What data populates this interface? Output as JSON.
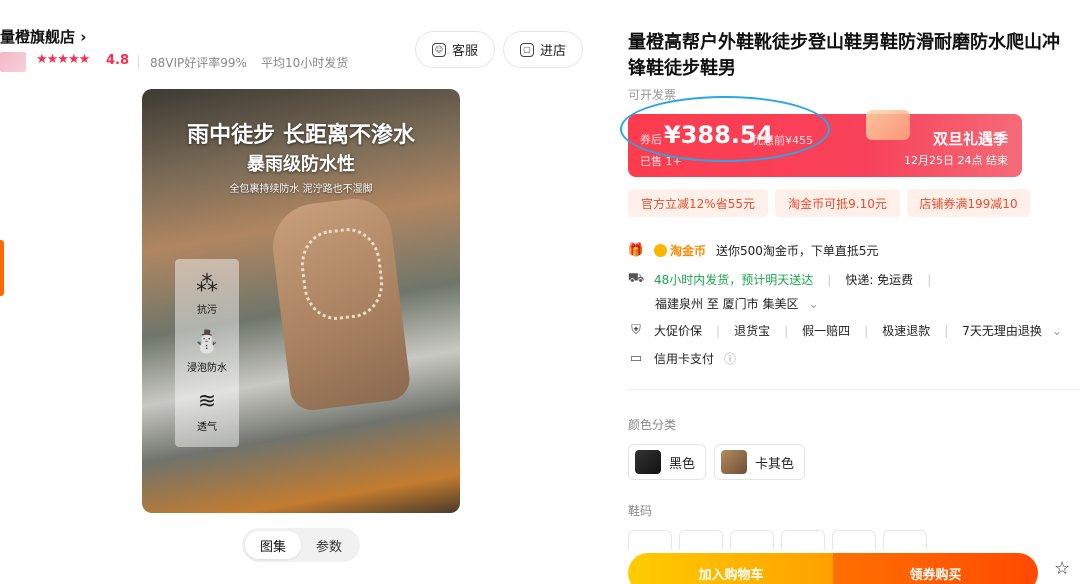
{
  "store": {
    "name": "量橙旗舰店",
    "chevron": "›",
    "stars": "★★★★★",
    "rating": "4.8",
    "vip_rate": "88VIP好评率99%",
    "avg_ship": "平均10小时发货"
  },
  "header_buttons": {
    "service": "客服",
    "enter_store": "进店"
  },
  "product_image": {
    "headline": "雨中徒步 长距离不渗水",
    "subheadline": "暴雨级防水性",
    "small_text": "全包裹持续防水 泥泞路也不湿脚",
    "features": [
      {
        "label": "抗污",
        "icon": "stain-resistant-icon"
      },
      {
        "label": "浸泡防水",
        "icon": "waterproof-boot-icon"
      },
      {
        "label": "透气",
        "icon": "breathable-icon"
      }
    ]
  },
  "gallery_tabs": [
    "图集",
    "参数"
  ],
  "product": {
    "title": "量橙高帮户外鞋靴徒步登山鞋男鞋防滑耐磨防水爬山冲锋鞋徒步鞋男",
    "invoice": "可开发票"
  },
  "price": {
    "label": "券后",
    "amount": "¥388.54",
    "original": "优惠前¥455",
    "sold": "已售 1+",
    "promo_title": "双旦礼遇季",
    "promo_time": "12月25日 24点 结束"
  },
  "coupons": [
    "官方立减12%省55元",
    "淘金币可抵9.10元",
    "店铺券满199减10"
  ],
  "services": {
    "coin_badge": "淘金币",
    "coin_text": "送你500淘金币，下单直抵5元",
    "ship_fast": "48小时内发货，预计明天送达",
    "freight": "快递: 免运费",
    "route": "福建泉州 至 厦门市 集美区",
    "guarantees": [
      "大促价保",
      "退货宝",
      "假一赔四",
      "极速退款",
      "7天无理由退换"
    ],
    "credit": "信用卡支付"
  },
  "options": {
    "color_label": "颜色分类",
    "colors": [
      "黑色",
      "卡其色"
    ],
    "size_label": "鞋码"
  },
  "actions": {
    "add_to_cart": "加入购物车",
    "buy_now": "领券购买"
  },
  "colors": {
    "price_red": "#ff3c4e",
    "coupon_text": "#f24a2a",
    "green": "#19a84b",
    "highlight": "#2ba6e8",
    "cart_yellow": "#ffb400",
    "buy_orange": "#ff5a00"
  }
}
